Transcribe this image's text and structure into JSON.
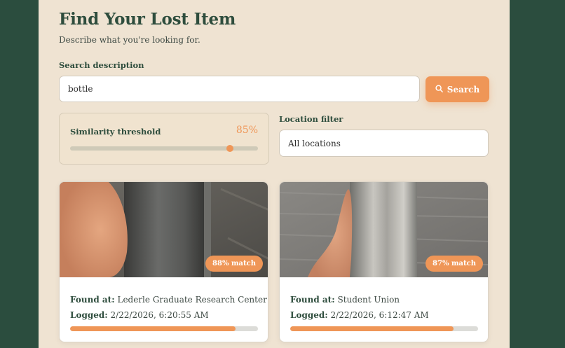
{
  "header": {
    "title": "Find Your Lost Item",
    "subtitle": "Describe what you're looking for."
  },
  "search": {
    "label": "Search description",
    "value": "bottle",
    "button_label": "Search",
    "button_icon": "search-icon"
  },
  "threshold": {
    "label": "Similarity threshold",
    "value_text": "85%",
    "value": 0.85
  },
  "location": {
    "label": "Location filter",
    "selected": "All locations"
  },
  "results": [
    {
      "badge": "88% match",
      "match": 0.88,
      "found_label": "Found at:",
      "found_value": "Lederle Graduate Research Center",
      "logged_label": "Logged:",
      "logged_value": "2/22/2026, 6:20:55 AM"
    },
    {
      "badge": "87% match",
      "match": 0.87,
      "found_label": "Found at:",
      "found_value": "Student Union",
      "logged_label": "Logged:",
      "logged_value": "2/22/2026, 6:12:47 AM"
    }
  ],
  "colors": {
    "background": "#2b4d3e",
    "panel": "#efe3d2",
    "accent": "#ef9657",
    "heading": "#2e4d3d"
  }
}
